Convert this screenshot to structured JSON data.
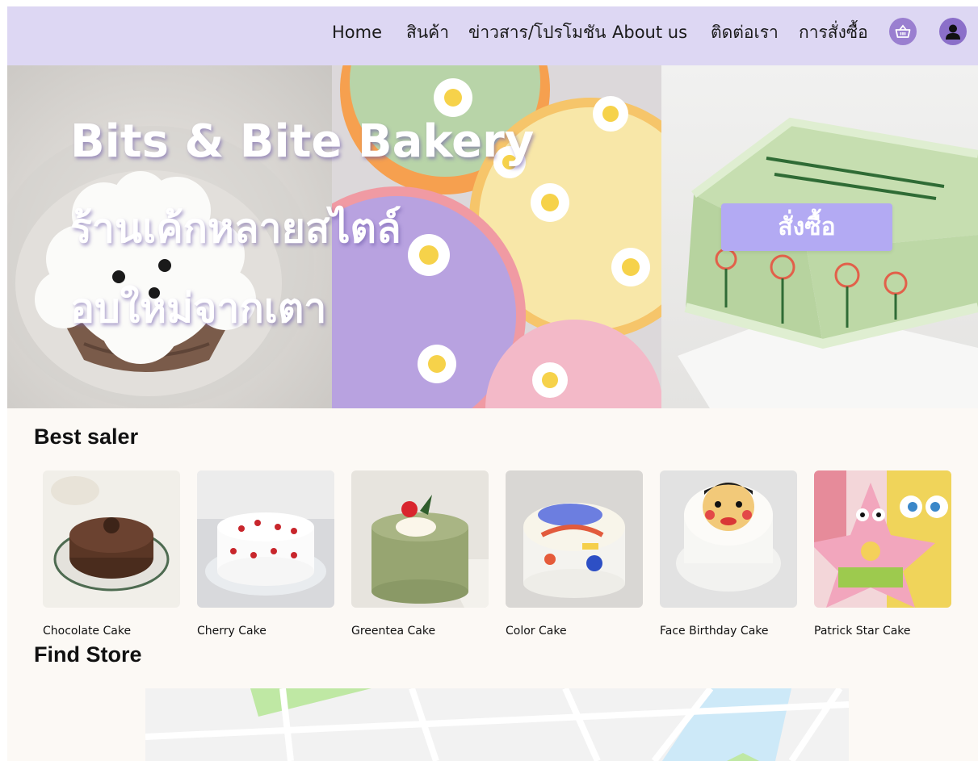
{
  "nav": {
    "links": [
      "Home",
      "สินค้า",
      "ข่าวสาร/โปรโมชัน",
      "About us",
      "ติดต่อเรา",
      "การสั่งซื้อ"
    ],
    "cart_icon": "basket-icon",
    "profile_icon": "user-icon"
  },
  "hero": {
    "title": "Bits & Bite Bakery",
    "subtitle_line1": "ร้านเค้กหลายสไตล์",
    "subtitle_line2": "อบใหม่จากเตา",
    "order_button": "สั่งซื้อ"
  },
  "best_seller": {
    "heading": "Best saler",
    "products": [
      {
        "name": "Chocolate Cake"
      },
      {
        "name": "Cherry Cake"
      },
      {
        "name": "Greentea Cake"
      },
      {
        "name": "Color Cake"
      },
      {
        "name": "Face Birthday Cake"
      },
      {
        "name": "Patrick Star Cake"
      }
    ]
  },
  "find_store": {
    "heading": "Find Store"
  },
  "colors": {
    "nav_bg": "#ddd7f3",
    "accent": "#b3aaf3",
    "icon_purple": "#9a7fd0",
    "page_bg": "#fcf9f5"
  }
}
